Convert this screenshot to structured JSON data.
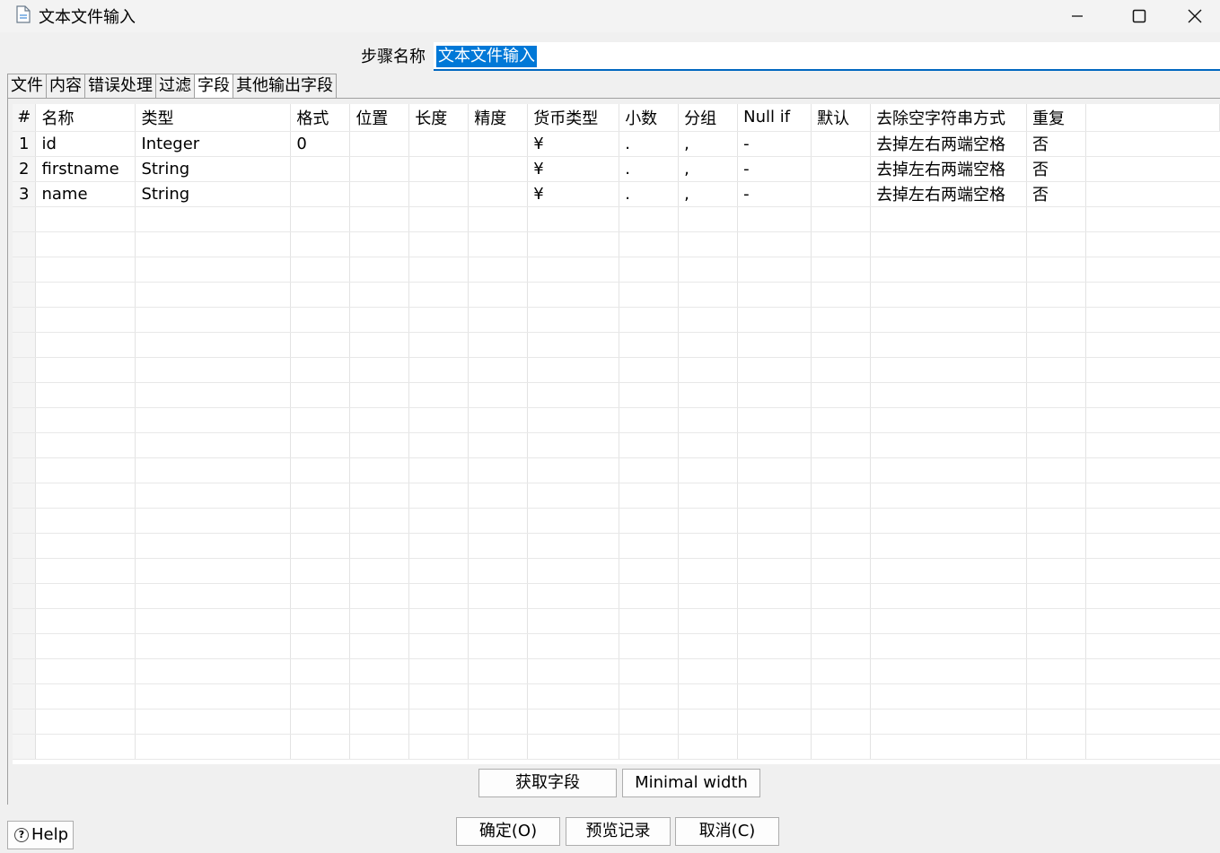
{
  "window": {
    "title": "文本文件输入",
    "controls": {
      "minimize": "minimize-icon",
      "maximize": "maximize-icon",
      "close": "close-icon"
    }
  },
  "step_name": {
    "label": "步骤名称",
    "value": "文本文件输入"
  },
  "tabs": [
    {
      "label": "文件",
      "active": false
    },
    {
      "label": "内容",
      "active": false
    },
    {
      "label": "错误处理",
      "active": false
    },
    {
      "label": "过滤",
      "active": false
    },
    {
      "label": "字段",
      "active": true
    },
    {
      "label": "其他输出字段",
      "active": false
    }
  ],
  "grid": {
    "columns": [
      "#",
      "名称",
      "类型",
      "格式",
      "位置",
      "长度",
      "精度",
      "货币类型",
      "小数",
      "分组",
      "Null if",
      "默认",
      "去除空字符串方式",
      "重复"
    ],
    "rows": [
      [
        "1",
        "id",
        "Integer",
        "0",
        "",
        "",
        "",
        "¥",
        ".",
        ",",
        "-",
        "",
        "去掉左右两端空格",
        "否"
      ],
      [
        "2",
        "firstname",
        "String",
        "",
        "",
        "",
        "",
        "¥",
        ".",
        ",",
        "-",
        "",
        "去掉左右两端空格",
        "否"
      ],
      [
        "3",
        "name",
        "String",
        "",
        "",
        "",
        "",
        "¥",
        ".",
        ",",
        "-",
        "",
        "去掉左右两端空格",
        "否"
      ]
    ]
  },
  "buttons": {
    "get_fields": "获取字段",
    "minimal_width": "Minimal width",
    "ok": "确定(O)",
    "preview": "预览记录",
    "cancel": "取消(C)",
    "help": "Help"
  }
}
